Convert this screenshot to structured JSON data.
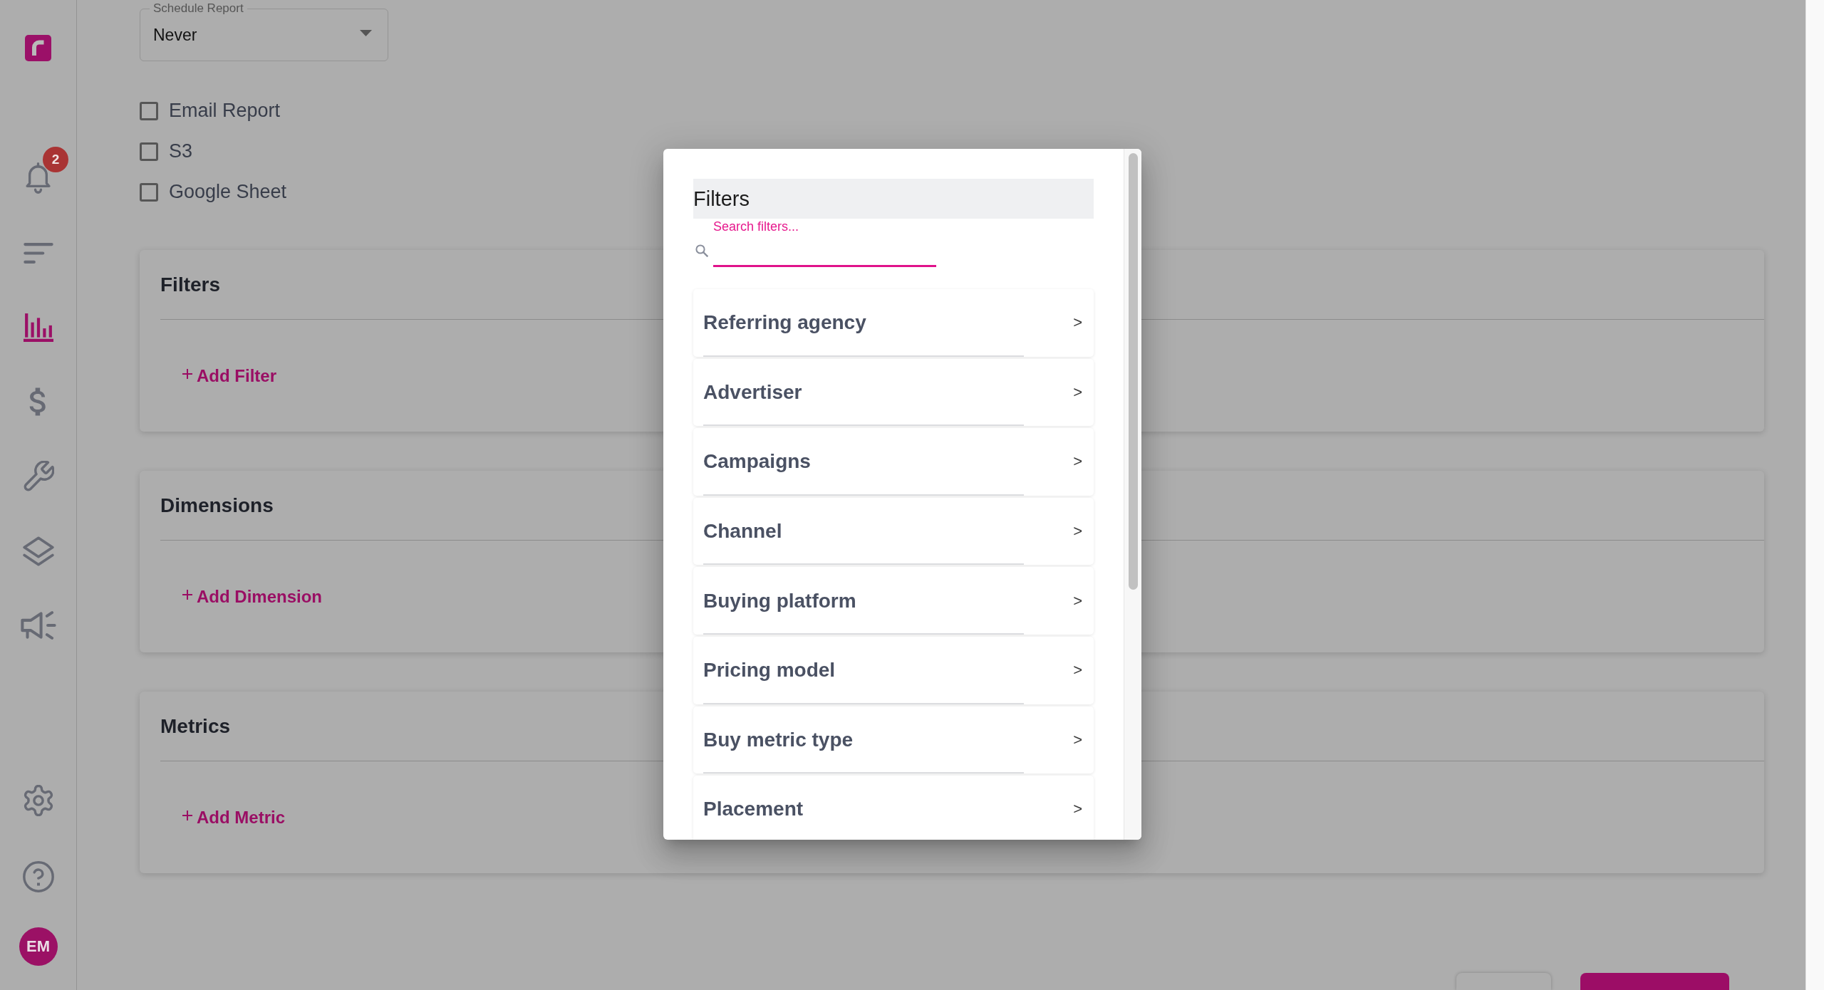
{
  "sidebar": {
    "nav_items": [
      {
        "kind": "bell",
        "selected": false,
        "badge": "2"
      },
      {
        "kind": "sort",
        "selected": false
      },
      {
        "kind": "chart",
        "selected": true
      },
      {
        "kind": "dollar",
        "selected": false
      },
      {
        "kind": "wrench",
        "selected": false
      },
      {
        "kind": "layers",
        "selected": false
      },
      {
        "kind": "megaphone",
        "selected": false
      }
    ],
    "bottom_items": [
      {
        "kind": "gear",
        "selected": false
      },
      {
        "kind": "help",
        "selected": false
      }
    ],
    "avatar": {
      "initials": "EM"
    }
  },
  "schedule": {
    "label": "Schedule Report",
    "value": "Never"
  },
  "destinations": [
    {
      "label": "Email Report",
      "checked": false
    },
    {
      "label": "S3",
      "checked": false
    },
    {
      "label": "Google Sheet",
      "checked": false
    }
  ],
  "sections": [
    {
      "title": "Filters",
      "action": "Add Filter"
    },
    {
      "title": "Dimensions",
      "action": "Add Dimension"
    },
    {
      "title": "Metrics",
      "action": "Add Metric"
    }
  ],
  "footer_buttons": [
    {
      "kind": "secondary"
    },
    {
      "kind": "primary"
    }
  ],
  "modal": {
    "title": "Filters",
    "search": {
      "label": "Search filters...",
      "focused": true
    },
    "options": [
      {
        "label": "Referring agency",
        "arrow": ">"
      },
      {
        "label": "Advertiser",
        "arrow": ">"
      },
      {
        "label": "Campaigns",
        "arrow": ">"
      },
      {
        "label": "Channel",
        "arrow": ">"
      },
      {
        "label": "Buying platform",
        "arrow": ">"
      },
      {
        "label": "Pricing model",
        "arrow": ">"
      },
      {
        "label": "Buy metric type",
        "arrow": ">"
      },
      {
        "label": "Placement",
        "arrow": ">"
      }
    ]
  }
}
